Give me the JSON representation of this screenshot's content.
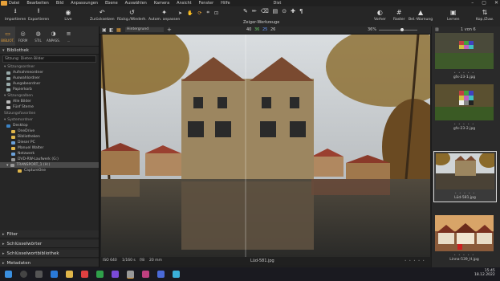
{
  "menu": [
    "Datei",
    "Bearbeiten",
    "Bild",
    "Anpassungen",
    "Ebene",
    "Auswählen",
    "Kamera",
    "Ansicht",
    "Fenster",
    "Hilfe"
  ],
  "window_title": "Dist",
  "toolbar": {
    "import": "Importieren",
    "export": "Exportieren",
    "live": "Live",
    "undo": "Zurücksetzen",
    "reset": "Rückg./Wiederh.",
    "auto": "Autom. anpassen",
    "cursor_label": "Zeiger-Werkzeuge",
    "compare": "Vorher",
    "grid": "Raster",
    "warning": "Bel.-Warnung",
    "learn": "Lernen",
    "copy": "Kop./Zuw."
  },
  "tool_tabs": [
    "BIBLIOT.",
    "FORM",
    "STIL",
    "ANPASS.",
    "..."
  ],
  "library": {
    "title": "Bibliothek",
    "filter_value": "Sitzung: Dieten Bilder",
    "session_folders_title": "Sitzungsordner",
    "session_folders": [
      "Aufnahmeordner",
      "Auswahlordner",
      "Ausgabeordner",
      "Papierkorb"
    ],
    "session_albums_title": "Sitzungsalben",
    "session_albums": [
      "Alle Bilder",
      "Fünf Sterne"
    ],
    "favorites_title": "Sitzungsfavoriten",
    "system_title": "Systemordner",
    "system": [
      "Desktop",
      "OneDrive",
      "Bibliotheken",
      "Dieser PC",
      "Manuel Walter",
      "Netzwerk",
      "DVD-RW-Laufwerk (G:)",
      "TRANSPORT_1 (H:)",
      "CaptureOne"
    ]
  },
  "bottom_sections": [
    "Filter",
    "Schlüsselwörter",
    "Schlüsselwortbibliothek",
    "Metadaten"
  ],
  "viewer": {
    "background_label": "Hintergrund",
    "histogram": [
      "40",
      "36",
      "25",
      "26"
    ],
    "zoom": "36%",
    "count": "1 von 6",
    "filename": "Lüd-581.jpg",
    "iso": "ISO 640",
    "shutter": "1/160 s",
    "aperture": "f/8",
    "focal": "20 mm"
  },
  "thumbnails": [
    {
      "name": "gfx-23-1.jpg",
      "stars": "• • • • •"
    },
    {
      "name": "gfx-23-2.jpg",
      "stars": "• • • • •"
    },
    {
      "name": "Lüd-581.jpg",
      "stars": "• • • • •"
    },
    {
      "name": "Linna-539_H.jpg",
      "stars": "• • • • •"
    }
  ],
  "clock": {
    "time": "15:45",
    "date": "18.12.2022"
  },
  "colors": {
    "accent": "#e8a23a",
    "panel": "#262626",
    "viewer": "#1f1f1f"
  }
}
